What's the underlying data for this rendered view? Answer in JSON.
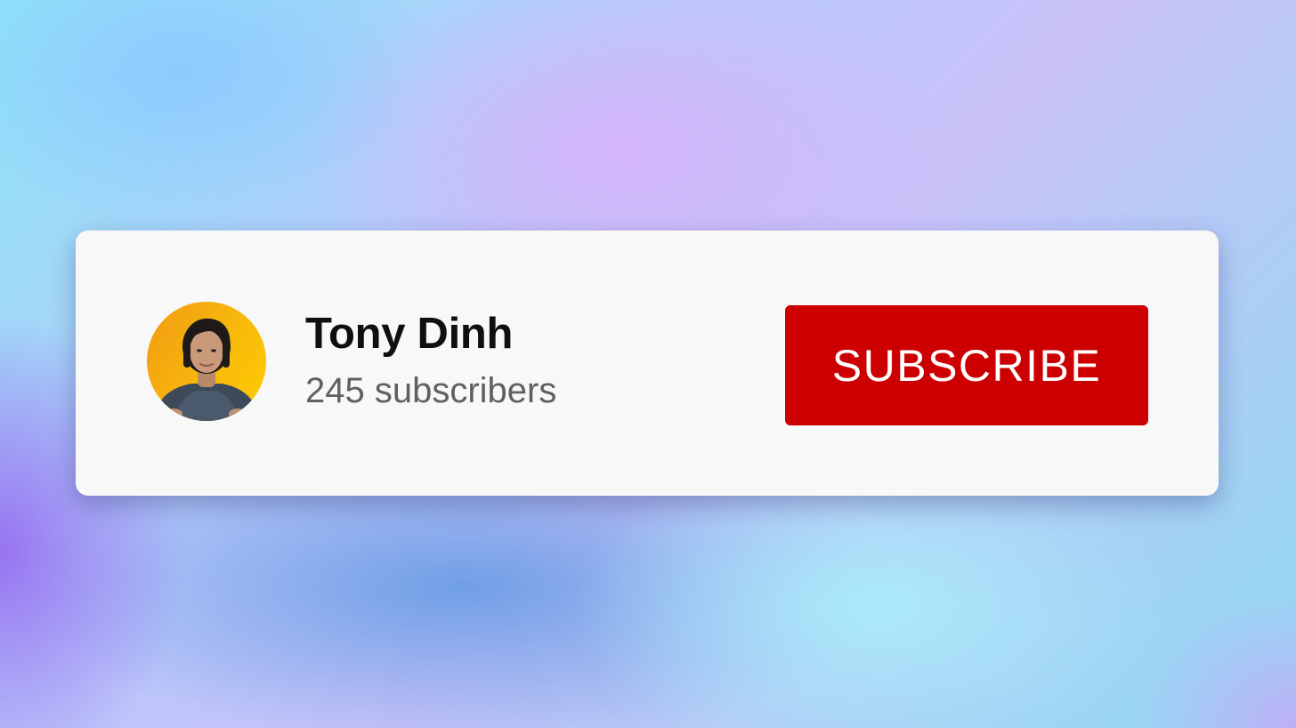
{
  "channel": {
    "name": "Tony Dinh",
    "subscribers": "245 subscribers",
    "avatar_icon": "user-avatar-photo"
  },
  "actions": {
    "subscribe_label": "SUBSCRIBE"
  },
  "colors": {
    "subscribe_button": "#cc0000",
    "card_background": "#f8f8f8",
    "name_text": "#0f0f0f",
    "subscriber_text": "#606060",
    "avatar_background": "#f7b90c"
  }
}
